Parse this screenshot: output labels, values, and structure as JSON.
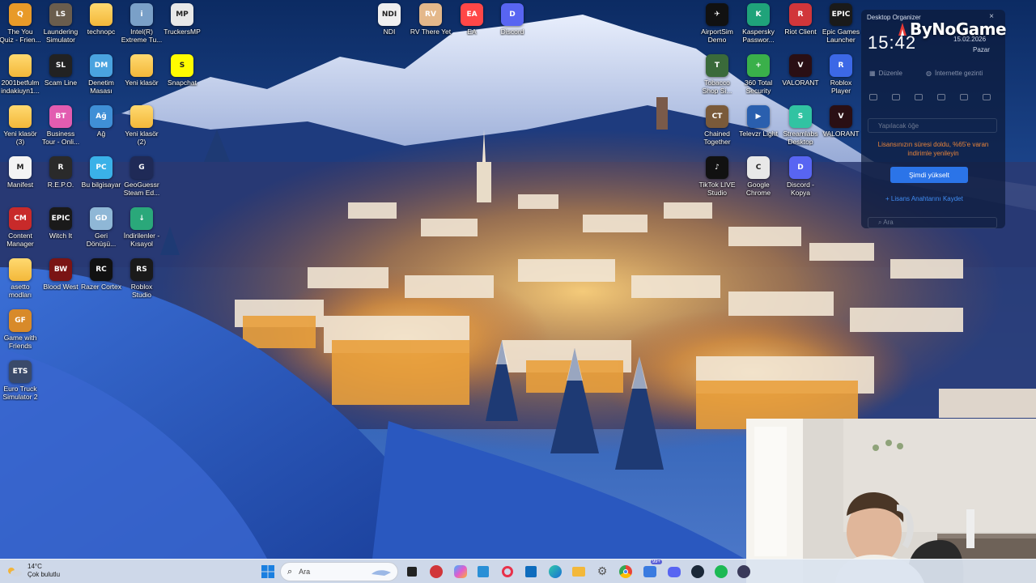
{
  "desktop": {
    "left_icons": [
      {
        "name": "the-you-quiz",
        "label": "The You\nQuiz - Frien...",
        "bg": "#e89a28",
        "glyph": "Q"
      },
      {
        "name": "laundering-simulator",
        "label": "Laundering\nSimulator",
        "bg": "#6a5d4d",
        "glyph": "LS"
      },
      {
        "name": "technopc",
        "label": "technopc",
        "folder": true
      },
      {
        "name": "intel-extreme-tuning",
        "label": "Intel(R)\nExtreme Tu...",
        "bg": "#7aa0c8",
        "glyph": "i"
      },
      {
        "name": "truckersmp",
        "label": "TruckersMP",
        "bg": "#e8e8e8",
        "glyph": "MP"
      },
      {
        "name": "2001betfulm",
        "label": "2001betfulm\nindakiuyn1...",
        "folder": true
      },
      {
        "name": "scam-line",
        "label": "Scam Line",
        "bg": "#222222",
        "glyph": "SL"
      },
      {
        "name": "denetim-masasi",
        "label": "Denetim\nMasası",
        "bg": "#4aa3df",
        "glyph": "DM"
      },
      {
        "name": "yeni-klasor",
        "label": "Yeni klasör",
        "folder": true
      },
      {
        "name": "snapchat",
        "label": "Snapchat",
        "bg": "#fffc00",
        "glyph": "S"
      },
      {
        "name": "yeni-klasor-3",
        "label": "Yeni klasör\n(3)",
        "folder": true
      },
      {
        "name": "business-tour",
        "label": "Business\nTour - Onli...",
        "bg": "#e25cb0",
        "glyph": "BT"
      },
      {
        "name": "ag",
        "label": "Ağ",
        "bg": "#3f8fd6",
        "glyph": "Ağ"
      },
      {
        "name": "yeni-klasor-2",
        "label": "Yeni klasör\n(2)",
        "folder": true
      },
      {
        "name": "manifest",
        "label": "Manifest",
        "bg": "#f4f4f4",
        "glyph": "M"
      },
      {
        "name": "repo",
        "label": "R.E.P.O.",
        "bg": "#2a2a2a",
        "glyph": "R"
      },
      {
        "name": "bu-bilgisayar",
        "label": "Bu bilgisayar",
        "bg": "#3ab1e8",
        "glyph": "PC"
      },
      {
        "name": "geoguessr",
        "label": "GeoGuessr\nSteam Ed...",
        "bg": "#1f2a57",
        "glyph": "G"
      },
      {
        "name": "content-manager",
        "label": "Content\nManager",
        "bg": "#c82a2a",
        "glyph": "CM"
      },
      {
        "name": "witch-it",
        "label": "Witch It",
        "bg": "#1a1a1a",
        "glyph": "EPIC"
      },
      {
        "name": "geri-donusum",
        "label": "Geri\nDönüşü...",
        "bg": "#8fb7d6",
        "glyph": "GD"
      },
      {
        "name": "indirilenler",
        "label": "İndirilenler -\nKısayol",
        "bg": "#2aa87a",
        "glyph": "↓"
      },
      {
        "name": "asetto-modlari",
        "label": "asetto\nmodları",
        "folder": true
      },
      {
        "name": "blood-west",
        "label": "Blood West",
        "bg": "#7a1414",
        "glyph": "BW"
      },
      {
        "name": "razer-cortex",
        "label": "Razer Cortex",
        "bg": "#111111",
        "glyph": "RC"
      },
      {
        "name": "roblox-studio",
        "label": "Roblox\nStudio",
        "bg": "#1a1a1a",
        "glyph": "RS"
      },
      {
        "name": "game-with-friends",
        "label": "Game with\nFriends",
        "bg": "#d88a2a",
        "glyph": "GF"
      },
      {
        "name": "euro-truck-simulator-2",
        "label": "Euro Truck\nSimulator 2",
        "bg": "#3a4a6a",
        "glyph": "ETS"
      }
    ],
    "middle_icons": [
      {
        "name": "ndi",
        "label": "NDI",
        "bg": "#f0f0f0",
        "glyph": "NDI"
      },
      {
        "name": "rv-there-yet",
        "label": "RV There Yet",
        "bg": "#e4b88a",
        "glyph": "RV"
      },
      {
        "name": "ea",
        "label": "EA",
        "bg": "#ff4747",
        "glyph": "EA"
      },
      {
        "name": "discord",
        "label": "Discord",
        "bg": "#5865f2",
        "glyph": "D"
      }
    ],
    "right_icons": [
      {
        "name": "airportsim-demo",
        "label": "AirportSim\nDemo",
        "bg": "#111111",
        "glyph": "✈"
      },
      {
        "name": "kaspersky",
        "label": "Kaspersky\nPasswor...",
        "bg": "#1fa37a",
        "glyph": "K"
      },
      {
        "name": "riot-client",
        "label": "Riot Client",
        "bg": "#d1363a",
        "glyph": "R"
      },
      {
        "name": "epic-games-launcher",
        "label": "Epic Games\nLauncher",
        "bg": "#1a1a1a",
        "glyph": "EPIC"
      },
      {
        "name": "tobacco-shop-simulator",
        "label": "Tobacco\nShop Si...",
        "bg": "#3a6a3a",
        "glyph": "T"
      },
      {
        "name": "360-total-security",
        "label": "360 Total\nSecurity",
        "bg": "#3ab04a",
        "glyph": "+"
      },
      {
        "name": "valorant-1",
        "label": "VALORANT",
        "bg": "#2a0f14",
        "glyph": "V"
      },
      {
        "name": "roblox-player",
        "label": "Roblox\nPlayer",
        "bg": "#3c68e6",
        "glyph": "R"
      },
      {
        "name": "chained-together",
        "label": "Chained\nTogether",
        "bg": "#7a5a3a",
        "glyph": "CT"
      },
      {
        "name": "televzr-light",
        "label": "Televzr Light",
        "bg": "#2a5fae",
        "glyph": "▶"
      },
      {
        "name": "streamlabs-desktop",
        "label": "Streamlabs\nDesktop",
        "bg": "#31c3a2",
        "glyph": "S"
      },
      {
        "name": "valorant-2",
        "label": "VALORANT",
        "bg": "#2a0f14",
        "glyph": "V"
      },
      {
        "name": "tiktok-live",
        "label": "TikTok LIVE\nStudio",
        "bg": "#111111",
        "glyph": "♪"
      },
      {
        "name": "google-chrome",
        "label": "Google\nChrome",
        "bg": "#e8e8e8",
        "glyph": "C"
      },
      {
        "name": "discord-kopya",
        "label": "Discord -\nKopya",
        "bg": "#5865f2",
        "glyph": "D"
      }
    ]
  },
  "organizer": {
    "title": "Desktop Organizer",
    "close": "×",
    "clock": "15:42",
    "date": "15.02.2026",
    "day": "Pazar",
    "edit_label": "Düzenle",
    "web_search_label": "İnternette gezinti",
    "task_placeholder": "Yapılacak öğe",
    "license_warning": "Lisansınızın süresi doldu, %65'e varan\nindirimle yenileyin",
    "upgrade_button": "Şimdi yükselt",
    "license_key_link": "Lisans Anahtarını Kaydet",
    "search_placeholder": "Ara"
  },
  "watermark": {
    "text": "ByNoGame"
  },
  "taskbar": {
    "weather_temp": "14°C",
    "weather_desc": "Çok bulutlu",
    "search_placeholder": "Ara",
    "notification_badge": "99+"
  },
  "colors": {
    "accent": "#2b74e8",
    "warning": "#e8843a",
    "link": "#3f8cf2",
    "taskbar_bg": "#dce4f0"
  }
}
